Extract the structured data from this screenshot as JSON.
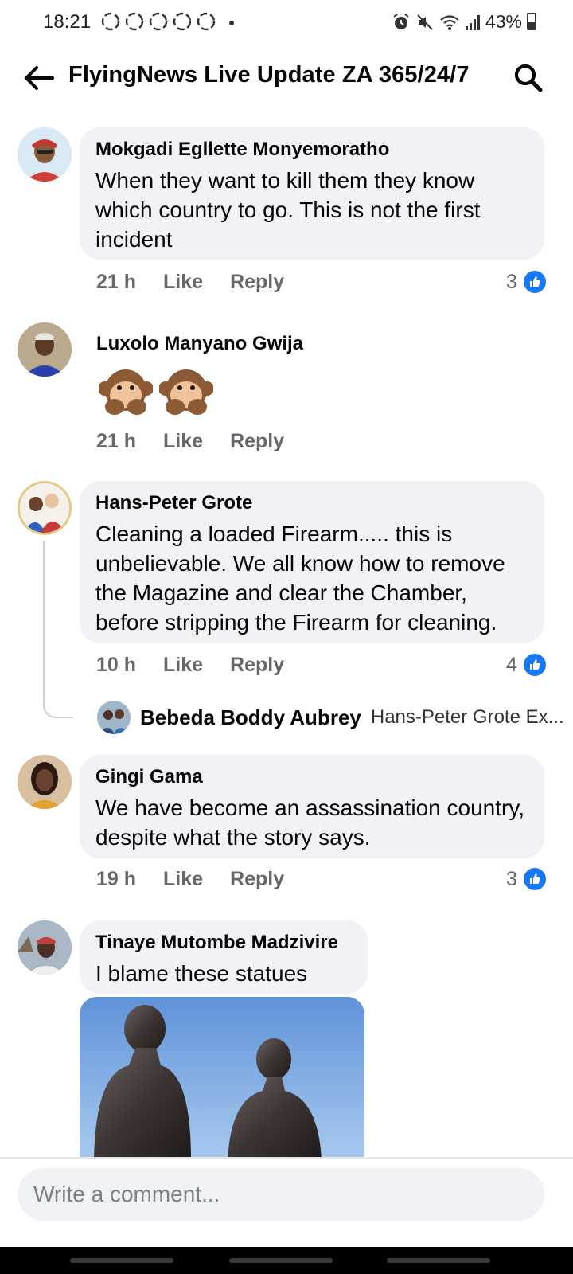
{
  "status_bar": {
    "time": "18:21",
    "battery": "43%",
    "icons": [
      "recycle-notification-icon",
      "recycle-notification-icon",
      "recycle-notification-icon",
      "recycle-notification-icon",
      "recycle-notification-icon",
      "alarm-icon",
      "mute-icon",
      "wifi-icon",
      "signal-icon",
      "battery-icon"
    ]
  },
  "header": {
    "title": "FlyingNews Live Update ZA 365/24/7",
    "back_icon": "back-arrow-icon",
    "search_icon": "search-icon"
  },
  "comments": [
    {
      "author": "Mokgadi Egllette Monyemoratho",
      "text": "When they want to kill them they know which country to go. This is not the first incident",
      "time": "21 h",
      "like_label": "Like",
      "reply_label": "Reply",
      "reactions": "3"
    },
    {
      "author": "Luxolo Manyano Gwija",
      "text": "🙊🙊",
      "time": "21 h",
      "like_label": "Like",
      "reply_label": "Reply"
    },
    {
      "author": "Hans-Peter Grote",
      "text": "Cleaning a loaded Firearm..... this is unbelievable. We all know how to remove the Magazine and clear the Chamber, before stripping the Firearm for cleaning.",
      "time": "10 h",
      "like_label": "Like",
      "reply_label": "Reply",
      "reactions": "4",
      "reply_preview": {
        "author": "Bebeda Boddy Aubrey",
        "text": "Hans-Peter Grote Ex..."
      }
    },
    {
      "author": "Gingi Gama",
      "text": "We have become an assassination country, despite what the story says.",
      "time": "19 h",
      "like_label": "Like",
      "reply_label": "Reply",
      "reactions": "3"
    },
    {
      "author": "Tinaye Mutombe Madzivire",
      "text": "I blame these statues",
      "image": "statues-photo"
    }
  ],
  "composer": {
    "placeholder": "Write a comment..."
  },
  "colors": {
    "bubble": "#f0f2f5",
    "meta": "#65676b",
    "like_blue": "#1877f2"
  }
}
